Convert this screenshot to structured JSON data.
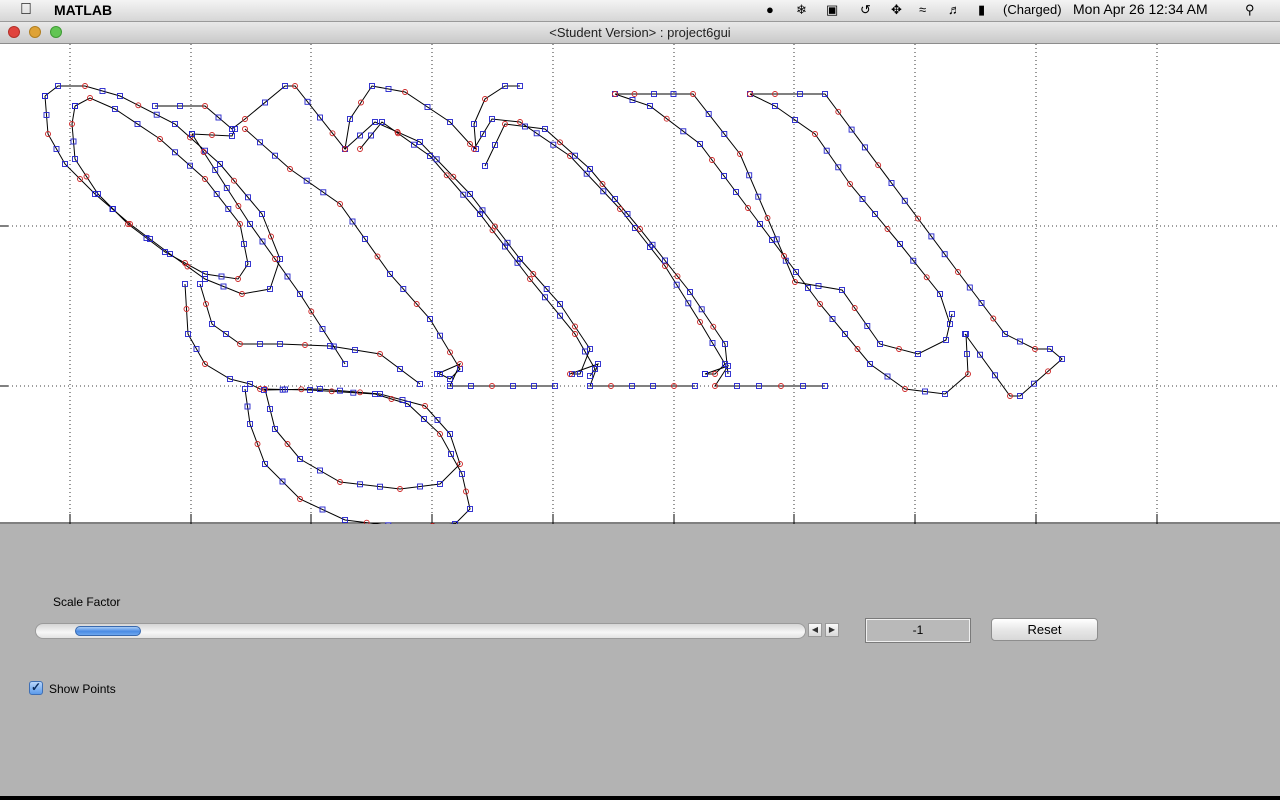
{
  "menubar": {
    "app_name": "MATLAB",
    "battery": "(Charged)",
    "datetime": "Mon Apr 26  12:34 AM",
    "icons": [
      "apple-icon",
      "script-icon",
      "paw-icon",
      "grid-icon",
      "time-machine-icon",
      "bluetooth-icon",
      "wifi-icon",
      "volume-icon",
      "battery-icon",
      "spotlight-icon"
    ]
  },
  "window": {
    "title": "<Student Version> : project6gui"
  },
  "plot": {
    "grid": true,
    "outline_color": "#000000",
    "knot_marker_color": "#2222cc",
    "mid_marker_color": "#cc2222"
  },
  "controls": {
    "scale_label": "Scale Factor",
    "scale_value": "-1",
    "slider_position": 0.05,
    "reset_label": "Reset",
    "show_points_label": "Show Points",
    "show_points_checked": true
  }
}
